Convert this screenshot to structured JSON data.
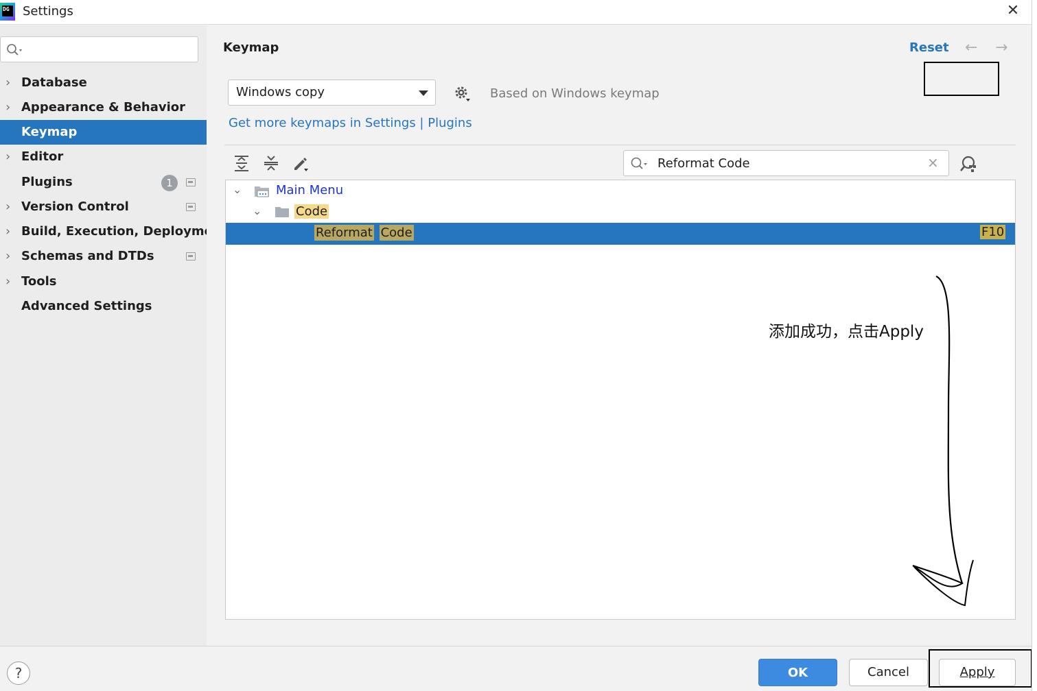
{
  "window": {
    "title": "Settings",
    "close": "✕",
    "logo_text": "DG"
  },
  "sidebar": {
    "search_placeholder": "",
    "items": [
      {
        "label": "Database",
        "expandable": true
      },
      {
        "label": "Appearance & Behavior",
        "expandable": true
      },
      {
        "label": "Keymap",
        "expandable": false,
        "selected": true
      },
      {
        "label": "Editor",
        "expandable": true
      },
      {
        "label": "Plugins",
        "expandable": false,
        "badge": "1"
      },
      {
        "label": "Version Control",
        "expandable": true
      },
      {
        "label": "Build, Execution, Deployment",
        "expandable": true
      },
      {
        "label": "Schemas and DTDs",
        "expandable": true
      },
      {
        "label": "Tools",
        "expandable": true
      },
      {
        "label": "Advanced Settings",
        "expandable": false
      }
    ]
  },
  "header": {
    "title": "Keymap",
    "reset": "Reset"
  },
  "keymap": {
    "selected": "Windows copy",
    "based_on": "Based on Windows keymap",
    "get_more": "Get more keymaps in Settings | Plugins"
  },
  "filter": {
    "value": "Reformat Code",
    "clear": "×"
  },
  "tree": {
    "root": "Main Menu",
    "group": "Code",
    "action_word1": "Reformat",
    "action_word2": "Code",
    "shortcut": "F10"
  },
  "annotation": "添加成功，点击Apply",
  "footer": {
    "help": "?",
    "ok": "OK",
    "cancel": "Cancel",
    "apply": "Apply"
  },
  "colors": {
    "accent": "#2675bf",
    "selection": "#2675bf",
    "highlight": "#f6d98a",
    "ok_button": "#3d8be0"
  }
}
